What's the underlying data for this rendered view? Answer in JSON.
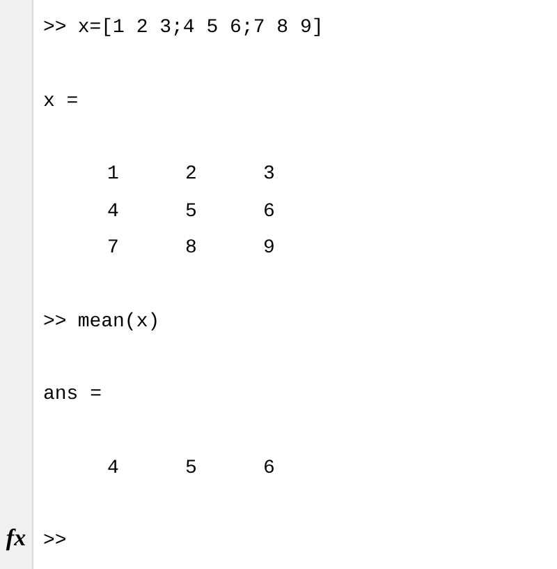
{
  "entries": [
    {
      "kind": "command",
      "prompt": ">>",
      "text": "x=[1 2 3;4 5 6;7 8 9]"
    },
    {
      "kind": "blank"
    },
    {
      "kind": "label",
      "text": "x ="
    },
    {
      "kind": "blank"
    },
    {
      "kind": "row",
      "cells": [
        "1",
        "2",
        "3"
      ]
    },
    {
      "kind": "row",
      "cells": [
        "4",
        "5",
        "6"
      ]
    },
    {
      "kind": "row",
      "cells": [
        "7",
        "8",
        "9"
      ]
    },
    {
      "kind": "blank"
    },
    {
      "kind": "command",
      "prompt": ">>",
      "text": "mean(x)"
    },
    {
      "kind": "blank"
    },
    {
      "kind": "label",
      "text": "ans ="
    },
    {
      "kind": "blank"
    },
    {
      "kind": "row",
      "cells": [
        "4",
        "5",
        "6"
      ]
    },
    {
      "kind": "blank"
    }
  ],
  "input_line": {
    "fx": "fx",
    "prompt": ">>"
  }
}
